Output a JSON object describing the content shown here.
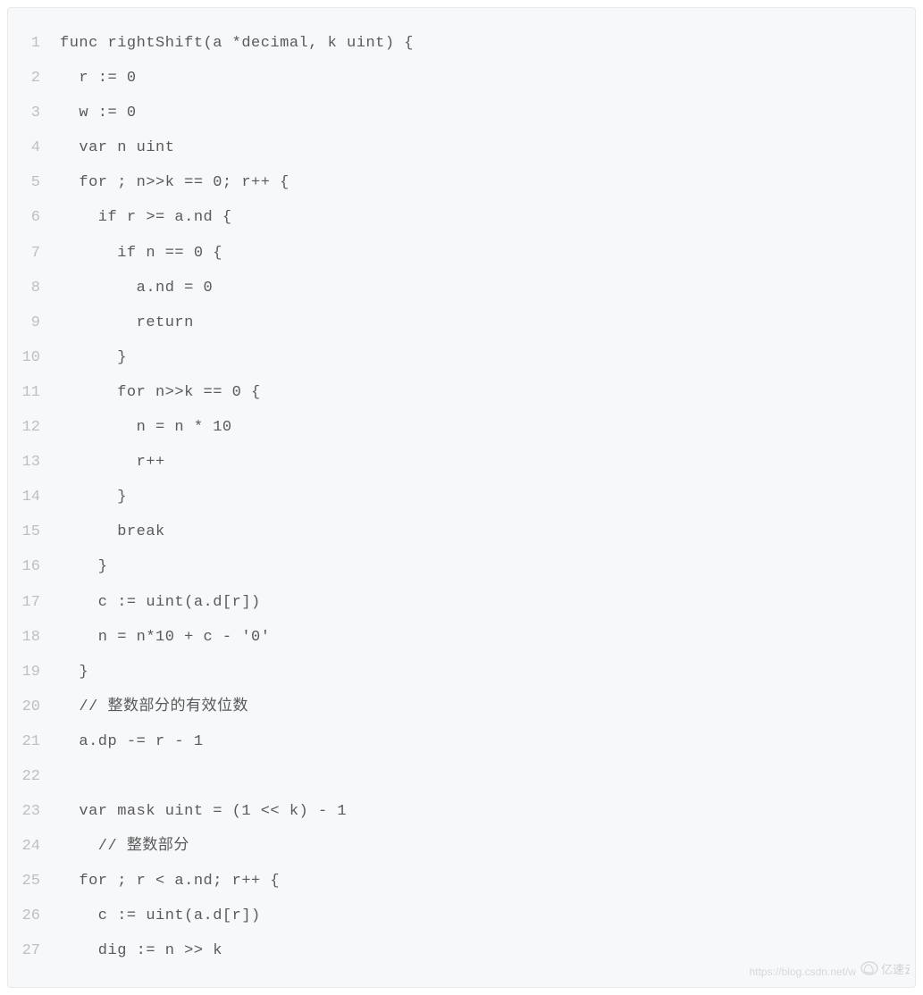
{
  "watermark_url": "https://blog.csdn.net/w",
  "watermark_brand": "亿速云",
  "code": [
    {
      "n": "1",
      "t": "func rightShift(a *decimal, k uint) {"
    },
    {
      "n": "2",
      "t": "  r := 0"
    },
    {
      "n": "3",
      "t": "  w := 0"
    },
    {
      "n": "4",
      "t": "  var n uint"
    },
    {
      "n": "5",
      "t": "  for ; n>>k == 0; r++ {"
    },
    {
      "n": "6",
      "t": "    if r >= a.nd {"
    },
    {
      "n": "7",
      "t": "      if n == 0 {"
    },
    {
      "n": "8",
      "t": "        a.nd = 0"
    },
    {
      "n": "9",
      "t": "        return"
    },
    {
      "n": "10",
      "t": "      }"
    },
    {
      "n": "11",
      "t": "      for n>>k == 0 {"
    },
    {
      "n": "12",
      "t": "        n = n * 10"
    },
    {
      "n": "13",
      "t": "        r++"
    },
    {
      "n": "14",
      "t": "      }"
    },
    {
      "n": "15",
      "t": "      break"
    },
    {
      "n": "16",
      "t": "    }"
    },
    {
      "n": "17",
      "t": "    c := uint(a.d[r])"
    },
    {
      "n": "18",
      "t": "    n = n*10 + c - '0'"
    },
    {
      "n": "19",
      "t": "  }"
    },
    {
      "n": "20",
      "t": "  // 整数部分的有效位数"
    },
    {
      "n": "21",
      "t": "  a.dp -= r - 1"
    },
    {
      "n": "22",
      "t": ""
    },
    {
      "n": "23",
      "t": "  var mask uint = (1 << k) - 1"
    },
    {
      "n": "24",
      "t": "    // 整数部分"
    },
    {
      "n": "25",
      "t": "  for ; r < a.nd; r++ {"
    },
    {
      "n": "26",
      "t": "    c := uint(a.d[r])"
    },
    {
      "n": "27",
      "t": "    dig := n >> k"
    }
  ]
}
